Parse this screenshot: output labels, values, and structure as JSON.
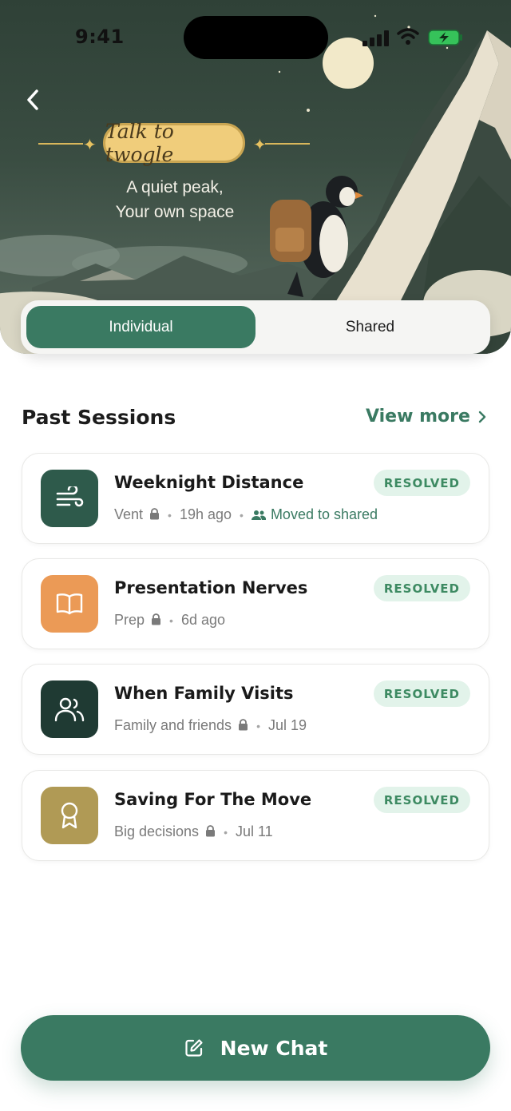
{
  "status_bar": {
    "time": "9:41"
  },
  "hero": {
    "badge": "Talk to twogle",
    "tagline_line1": "A quiet peak,",
    "tagline_line2": "Your own space"
  },
  "segmented": {
    "individual": "Individual",
    "shared": "Shared",
    "selected": "Individual"
  },
  "past_sessions": {
    "title": "Past Sessions",
    "view_more": "View more",
    "items": [
      {
        "title": "Weeknight Distance",
        "category": "Vent",
        "time": "19h ago",
        "moved": "Moved to shared",
        "status": "RESOLVED",
        "icon": "wind-icon",
        "color": "#2e5a4b"
      },
      {
        "title": "Presentation Nerves",
        "category": "Prep",
        "time": "6d ago",
        "status": "RESOLVED",
        "icon": "book-icon",
        "color": "#eb9a56"
      },
      {
        "title": "When Family Visits",
        "category": "Family and friends",
        "time": "Jul 19",
        "status": "RESOLVED",
        "icon": "people-icon",
        "color": "#1f3a33"
      },
      {
        "title": "Saving For The Move",
        "category": "Big decisions",
        "time": "Jul 11",
        "status": "RESOLVED",
        "icon": "award-icon",
        "color": "#b09a55"
      }
    ]
  },
  "new_chat": {
    "label": "New Chat"
  },
  "colors": {
    "accent": "#3a7a62",
    "status_bg": "#e2f3ea",
    "status_text": "#3d8a62"
  }
}
